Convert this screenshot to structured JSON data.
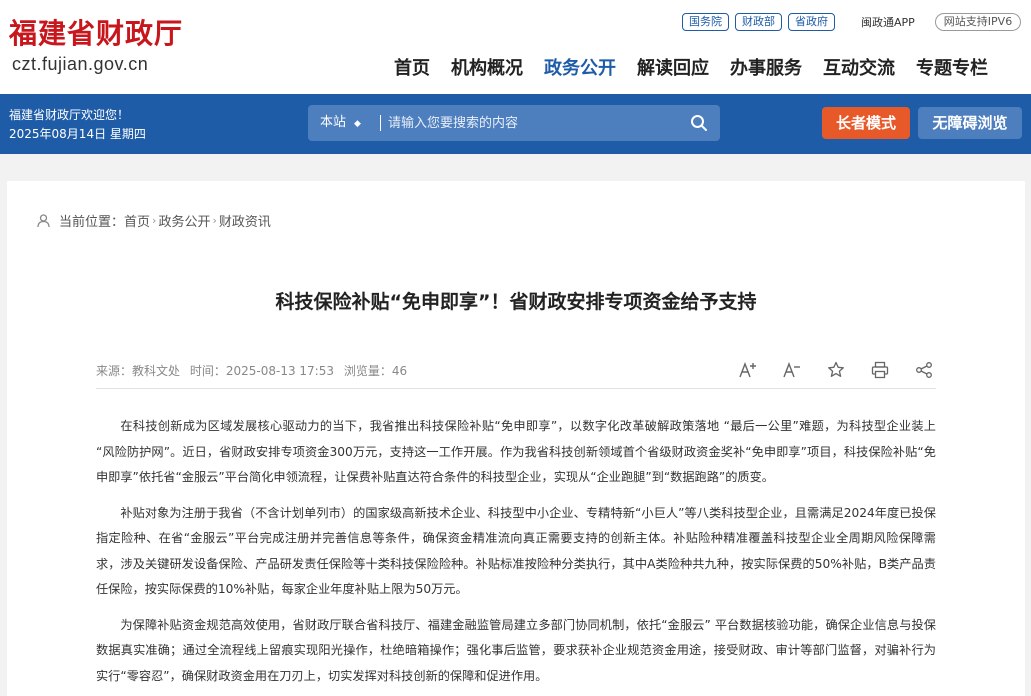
{
  "header": {
    "logo_cn": "福建省财政厅",
    "logo_en": "czt.fujian.gov.cn",
    "top_links": [
      "国务院",
      "财政部",
      "省政府"
    ],
    "app_link": "闽政通APP",
    "ipv6_badge": "网站支持IPV6",
    "nav": [
      "首页",
      "机构概况",
      "政务公开",
      "解读回应",
      "办事服务",
      "互动交流",
      "专题专栏"
    ],
    "active_nav": "政务公开"
  },
  "bluebar": {
    "welcome": "福建省财政厅欢迎您！",
    "date": "2025年08月14日 星期四",
    "search_scope": "本站",
    "search_placeholder": "请输入您要搜索的内容",
    "elder_mode": "长者模式",
    "accessibility": "无障碍浏览"
  },
  "breadcrumb": {
    "label": "当前位置：",
    "items": [
      "首页",
      "政务公开",
      "财政资讯"
    ]
  },
  "article": {
    "title": "科技保险补贴“免申即享”！省财政安排专项资金给予支持",
    "source": "来源：教科文处",
    "time": "时间：2025-08-13 17:53",
    "views": "浏览量：46",
    "paragraphs": [
      "在科技创新成为区域发展核心驱动力的当下，我省推出科技保险补贴“免申即享”，以数字化改革破解政策落地 “最后一公里”难题，为科技型企业装上 “风险防护网”。近日，省财政安排专项资金300万元，支持这一工作开展。作为我省科技创新领域首个省级财政资金奖补“免申即享”项目，科技保险补贴“免申即享”依托省“金服云”平台简化申领流程，让保费补贴直达符合条件的科技型企业，实现从“企业跑腿”到“数据跑路”的质变。",
      "补贴对象为注册于我省（不含计划单列市）的国家级高新技术企业、科技型中小企业、专精特新“小巨人”等八类科技型企业，且需满足2024年度已投保指定险种、在省“金服云”平台完成注册并完善信息等条件，确保资金精准流向真正需要支持的创新主体。补贴险种精准覆盖科技型企业全周期风险保障需求，涉及关键研发设备保险、产品研发责任保险等十类科技保险险种。补贴标准按险种分类执行，其中A类险种共九种，按实际保费的50%补贴，B类产品责任保险，按实际保费的10%补贴，每家企业年度补贴上限为50万元。",
      "为保障补贴资金规范高效使用，省财政厅联合省科技厅、福建金融监管局建立多部门协同机制，依托“金服云” 平台数据核验功能，确保企业信息与投保数据真实准确；通过全流程线上留痕实现阳光操作，杜绝暗箱操作；强化事后监管，要求获补企业规范资金用途，接受财政、审计等部门监督，对骗补行为实行“零容忍”，确保财政资金用在刀刃上，切实发挥对科技创新的保障和促进作用。"
    ]
  },
  "colors": {
    "brand_red": "#c8161d",
    "brand_blue": "#1f5ca8",
    "elder_orange": "#e8592a"
  }
}
